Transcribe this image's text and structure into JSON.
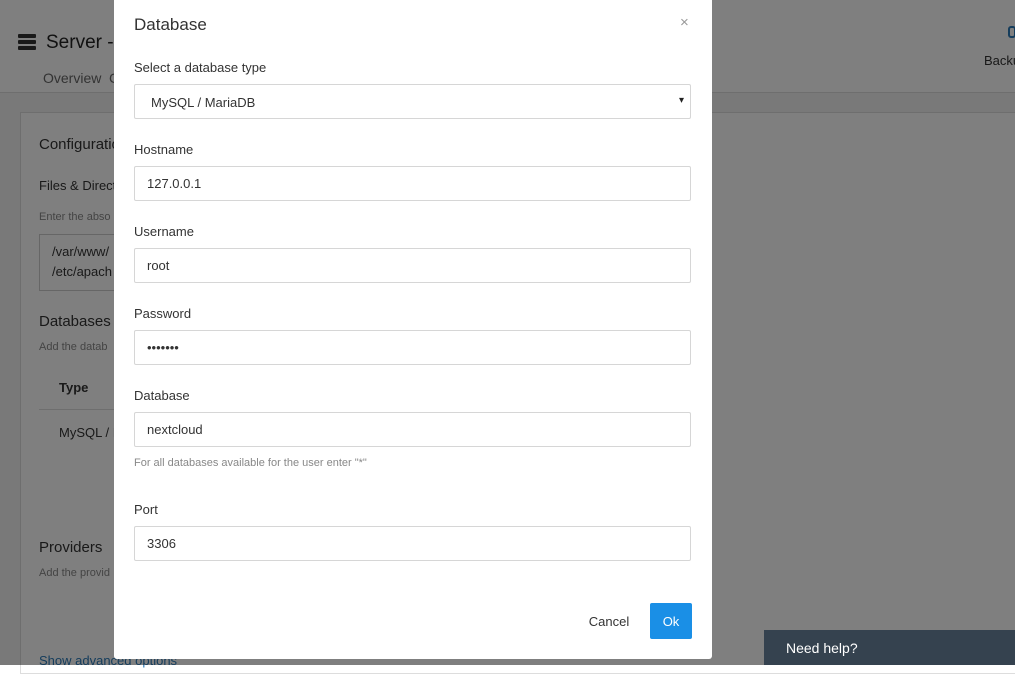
{
  "background": {
    "header": {
      "title": "Server - ",
      "tabs": [
        "Overview",
        "C"
      ],
      "backup_label": "Backu"
    },
    "card": {
      "section_title": "Configuratio",
      "files_label": "Files & Direct",
      "files_help": "Enter the abso",
      "paths": [
        "/var/www/",
        "/etc/apach"
      ],
      "databases_title": "Databases",
      "databases_help": "Add the datab",
      "table_header_type": "Type",
      "table_row_type": "MySQL / I",
      "providers_title": "Providers",
      "providers_help": "Add the provid",
      "advanced_link": "Show advanced options"
    }
  },
  "modal": {
    "title": "Database",
    "close_symbol": "×",
    "db_type": {
      "label": "Select a database type",
      "value": "MySQL / MariaDB",
      "caret": "▾"
    },
    "hostname": {
      "label": "Hostname",
      "value": "127.0.0.1"
    },
    "username": {
      "label": "Username",
      "value": "root"
    },
    "password": {
      "label": "Password",
      "value": "•••••••"
    },
    "database": {
      "label": "Database",
      "value": "nextcloud",
      "help": "For all databases available for the user enter \"*\""
    },
    "port": {
      "label": "Port",
      "value": "3306"
    },
    "cancel_label": "Cancel",
    "ok_label": "Ok"
  },
  "help_widget": {
    "label": "Need help?"
  },
  "colors": {
    "accent": "#1a8fe6",
    "overlay": "rgba(0,0,0,0.5)",
    "help_widget_bg": "#35424f"
  }
}
